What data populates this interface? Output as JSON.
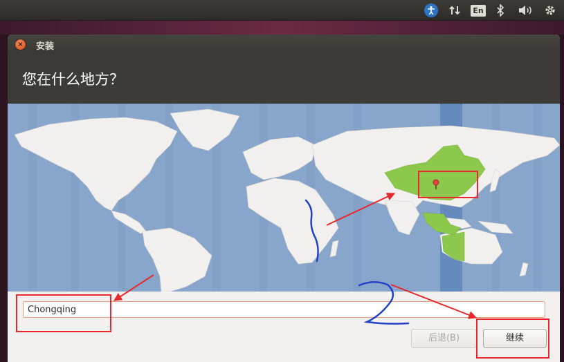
{
  "panel": {
    "accessibility_icon": "accessibility-icon",
    "network_icon": "network-arrows-icon",
    "language_label": "En",
    "bluetooth_icon": "bluetooth-icon",
    "volume_icon": "volume-icon",
    "settings_icon": "gear-icon"
  },
  "window": {
    "title": "安装",
    "close_icon": "close-icon"
  },
  "page": {
    "title": "您在什么地方？"
  },
  "map": {
    "selected_timezone_highlight": "China",
    "marker_icon": "location-pin-icon"
  },
  "location": {
    "value": "Chongqing"
  },
  "buttons": {
    "back_label": "后退(B)",
    "continue_label": "继续"
  },
  "colors": {
    "map_ocean": "#88a6cc",
    "land": "#f2f0ee",
    "timezone_highlight": "#8cc84b",
    "annotation_red": "#e8282a",
    "annotation_blue": "#2240c8"
  }
}
